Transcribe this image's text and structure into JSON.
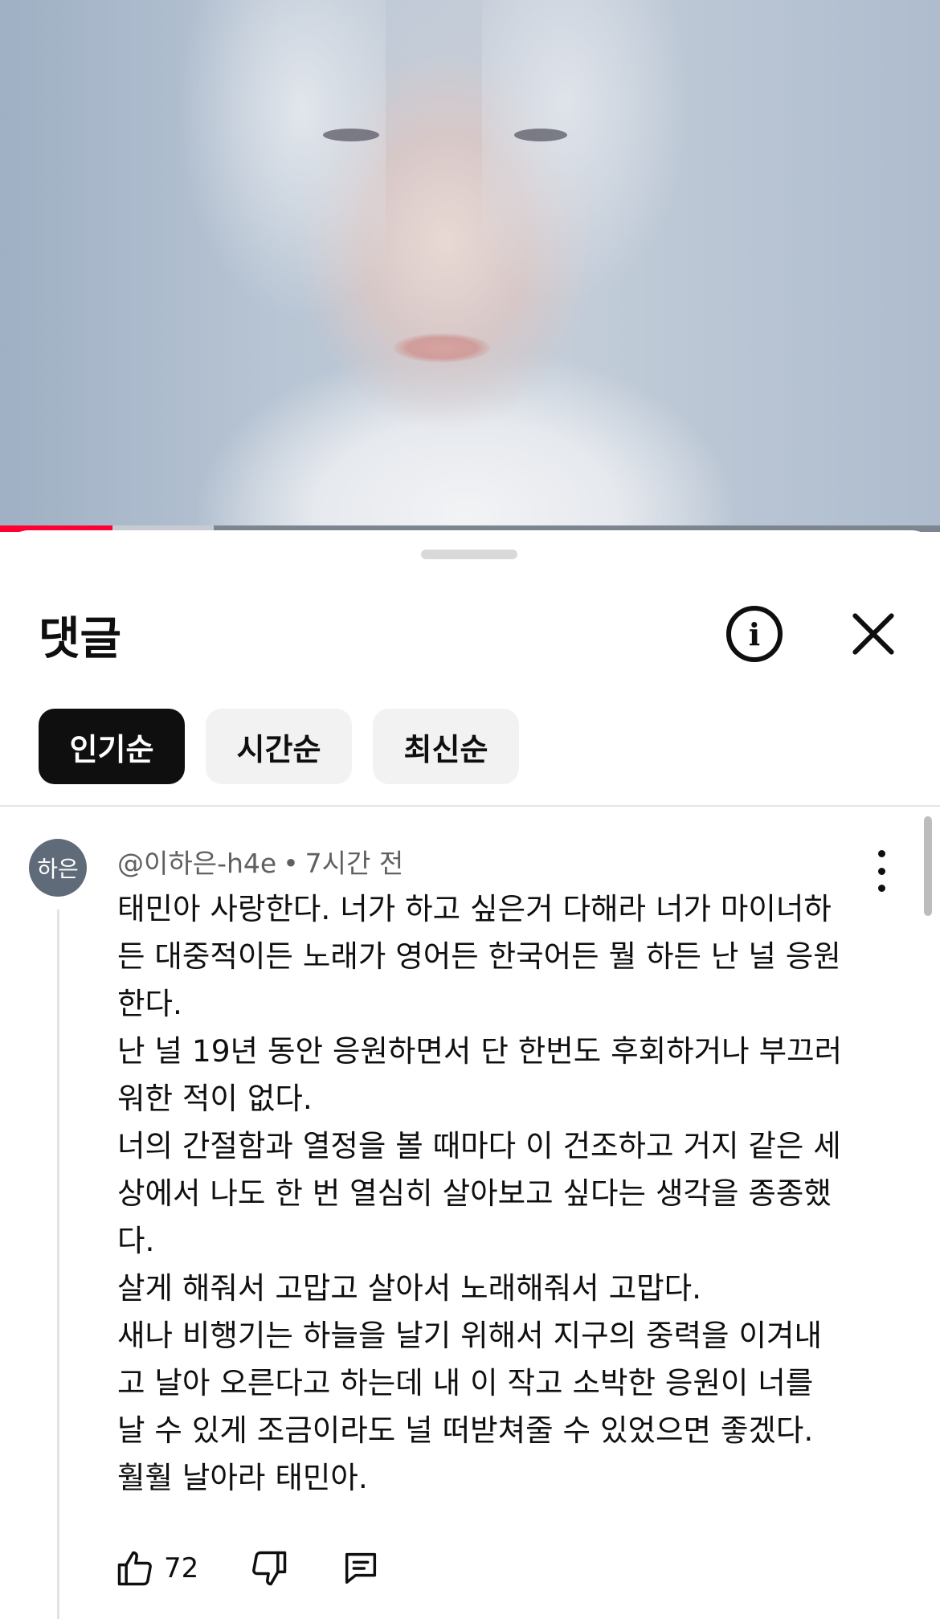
{
  "video": {
    "progress_played_fraction": 0.12,
    "progress_buffered_fraction": 0.227
  },
  "comments_panel": {
    "title": "댓글",
    "sort_chips": [
      {
        "label": "인기순",
        "active": true
      },
      {
        "label": "시간순",
        "active": false
      },
      {
        "label": "최신순",
        "active": false
      }
    ]
  },
  "comment": {
    "avatar_text": "하은",
    "author": "@이하은-h4e",
    "time": "7시간 전",
    "body_lines": [
      "태민아 사랑한다. 너가 하고 싶은거 다해라 너가 마이너하",
      "든 대중적이든 노래가 영어든 한국어든 뭘 하든 난 널 응원",
      "한다.",
      "난 널 19년 동안 응원하면서 단 한번도 후회하거나 부끄러",
      "워한 적이 없다.",
      "너의 간절함과 열정을 볼 때마다 이 건조하고 거지 같은 세",
      "상에서 나도 한 번 열심히 살아보고 싶다는 생각을 종종했",
      "다.",
      "살게 해줘서 고맙고 살아서 노래해줘서 고맙다.",
      "새나 비행기는 하늘을 날기 위해서 지구의 중력을 이겨내",
      "고 날아 오른다고 하는데 내 이 작고 소박한 응원이 너를",
      "날 수 있게 조금이라도 널 떠받쳐줄 수 있었으면 좋겠다.",
      "훨훨 날아라 태민아."
    ],
    "like_count": "72"
  },
  "icons": {
    "info": "info-icon",
    "close": "close-icon",
    "more": "more-vert-icon",
    "like": "thumbs-up-icon",
    "dislike": "thumbs-down-icon",
    "reply": "reply-icon"
  }
}
